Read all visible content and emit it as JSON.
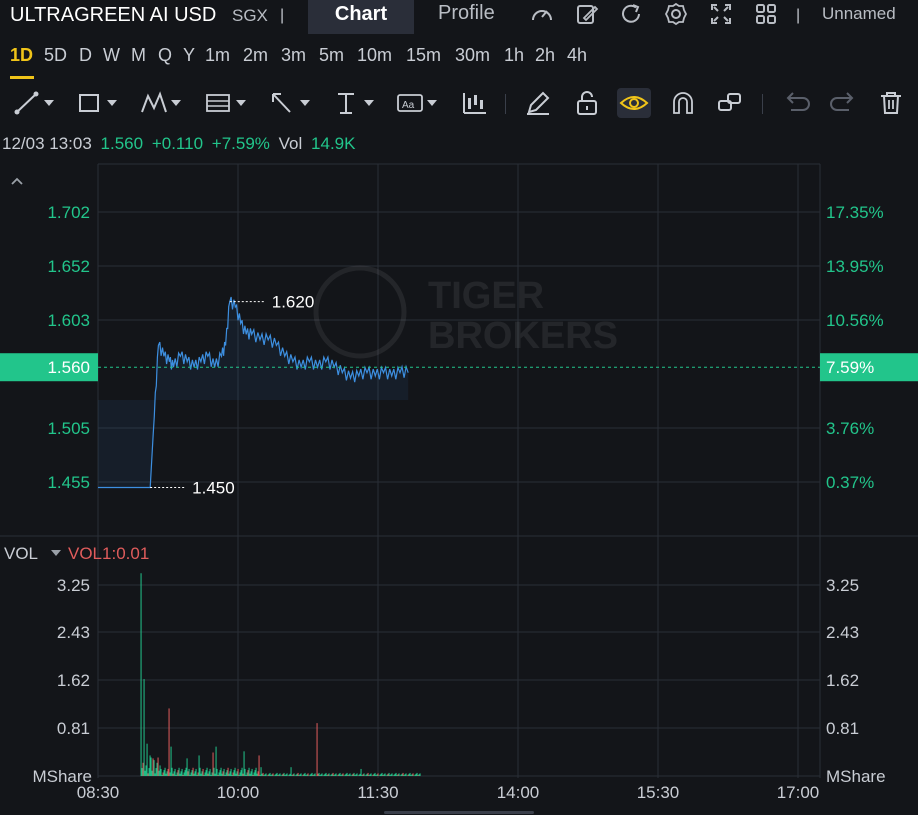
{
  "header": {
    "title": "ULTRAGREEN AI USD",
    "exchange": "SGX",
    "tab_chart": "Chart",
    "tab_profile": "Profile",
    "icons": [
      "speed-icon",
      "edit-note-icon",
      "refresh-icon",
      "settings-icon",
      "fullscreen-icon",
      "layout-grid-icon"
    ],
    "layout_name": "Unnamed"
  },
  "intervals": [
    "1D",
    "5D",
    "D",
    "W",
    "M",
    "Q",
    "Y",
    "1m",
    "2m",
    "3m",
    "5m",
    "10m",
    "15m",
    "30m",
    "1h",
    "2h",
    "4h"
  ],
  "active_interval": "1D",
  "toolbar": [
    "trend-line-icon",
    "rectangle-icon",
    "pattern-icon",
    "fibonacci-icon",
    "arrow-icon",
    "vertical-line-icon",
    "text-icon",
    "indicator-icon",
    "pencil-icon",
    "unlock-icon",
    "eye-icon",
    "magnet-icon",
    "group-icon",
    "undo-icon",
    "redo-icon",
    "trash-icon"
  ],
  "info": {
    "datetime": "12/03 13:03",
    "price": "1.560",
    "change": "+0.110",
    "change_pct": "+7.59%",
    "vol_label": "Vol",
    "vol_value": "14.9K"
  },
  "price_axis": [
    "1.702",
    "1.652",
    "1.603",
    "1.505",
    "1.455"
  ],
  "pct_axis": [
    "17.35%",
    "13.95%",
    "10.56%",
    "3.76%",
    "0.37%"
  ],
  "current_price": "1.560",
  "current_pct": "7.59%",
  "high_label": "1.620",
  "low_label": "1.450",
  "watermark": [
    "TIGER",
    "BROKERS"
  ],
  "volume": {
    "label": "VOL",
    "indicator": "VOL1:0.01",
    "axis": [
      "3.25",
      "2.43",
      "1.62",
      "0.81"
    ],
    "unit": "MShare"
  },
  "time_axis": [
    "08:30",
    "10:00",
    "11:30",
    "14:00",
    "15:30",
    "17:00"
  ],
  "colors": {
    "up": "#22c58b",
    "down": "#e05c5c",
    "line": "#3d8fe0",
    "accent": "#f0c419",
    "price_tag": "#22c58b"
  },
  "chart_data": {
    "type": "line",
    "title": "",
    "x": [
      "08:30",
      "09:08",
      "09:11",
      "09:14",
      "09:18",
      "09:22",
      "09:25",
      "09:30",
      "09:35",
      "09:40",
      "09:45",
      "09:50",
      "09:55",
      "10:00",
      "10:03",
      "10:06",
      "10:10",
      "10:14",
      "10:18",
      "10:22",
      "10:28",
      "10:34",
      "10:40",
      "10:46",
      "10:52",
      "10:58",
      "11:04",
      "11:10",
      "11:16",
      "11:22",
      "11:28",
      "11:34",
      "11:40",
      "11:46",
      "11:52",
      "11:58",
      "12:04",
      "12:10",
      "12:16"
    ],
    "series": [
      {
        "values": [
          1.45,
          1.45,
          1.515,
          1.58,
          1.57,
          1.565,
          1.56,
          1.57,
          1.565,
          1.56,
          1.565,
          1.57,
          1.56,
          1.57,
          1.58,
          1.62,
          1.615,
          1.6,
          1.59,
          1.59,
          1.585,
          1.585,
          1.58,
          1.57,
          1.565,
          1.56,
          1.565,
          1.56,
          1.565,
          1.56,
          1.555,
          1.55,
          1.552,
          1.555,
          1.552,
          1.555,
          1.552,
          1.555,
          1.555
        ]
      }
    ],
    "ylim": [
      1.435,
      1.72
    ],
    "xlim": [
      "08:30",
      "17:00"
    ],
    "volume_ylim": [
      0,
      3.5
    ]
  }
}
